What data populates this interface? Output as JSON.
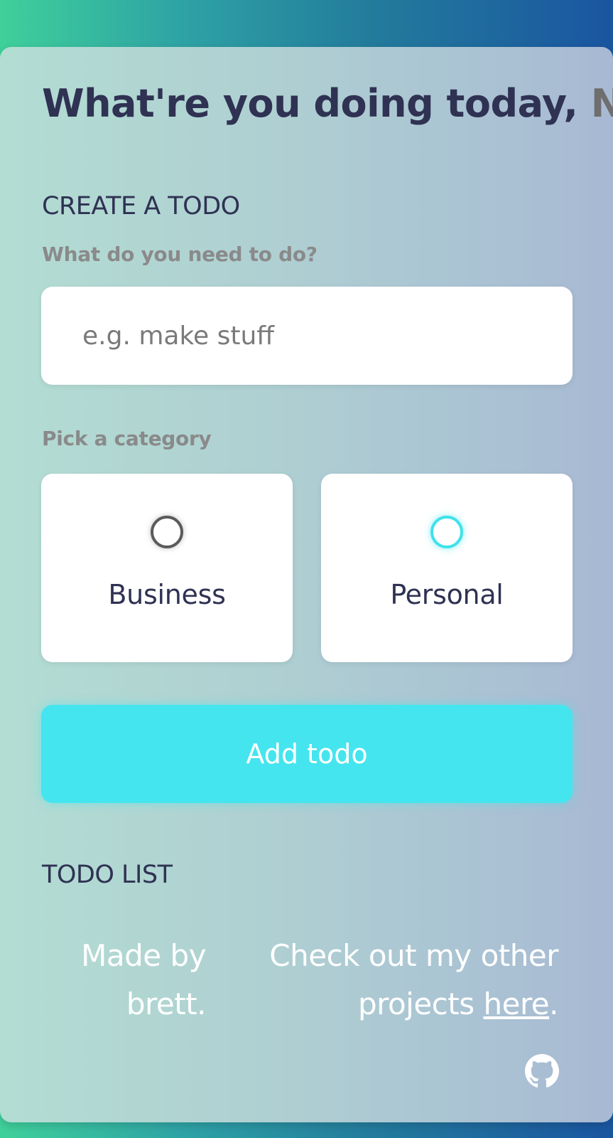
{
  "greeting": {
    "text": "What're you doing today,",
    "name": " N"
  },
  "create": {
    "section_title": "CREATE A TODO",
    "todo_label": "What do you need to do?",
    "todo_placeholder": "e.g. make stuff",
    "todo_value": "",
    "category_label": "Pick a category",
    "categories": [
      {
        "label": "Business",
        "selected": false,
        "color": "#5b5b5b"
      },
      {
        "label": "Personal",
        "selected": false,
        "color": "#3fe2ea"
      }
    ],
    "add_button_label": "Add todo"
  },
  "list": {
    "section_title": "TODO LIST",
    "items": []
  },
  "footer": {
    "made_by": "Made by brett.",
    "projects_prefix": "Check out my other projects ",
    "projects_link": "here",
    "projects_suffix": ".",
    "github_icon": "github-icon"
  },
  "colors": {
    "accent": "#44e5ee",
    "text_dark": "#2f3253",
    "text_muted": "#8a8a8a"
  }
}
